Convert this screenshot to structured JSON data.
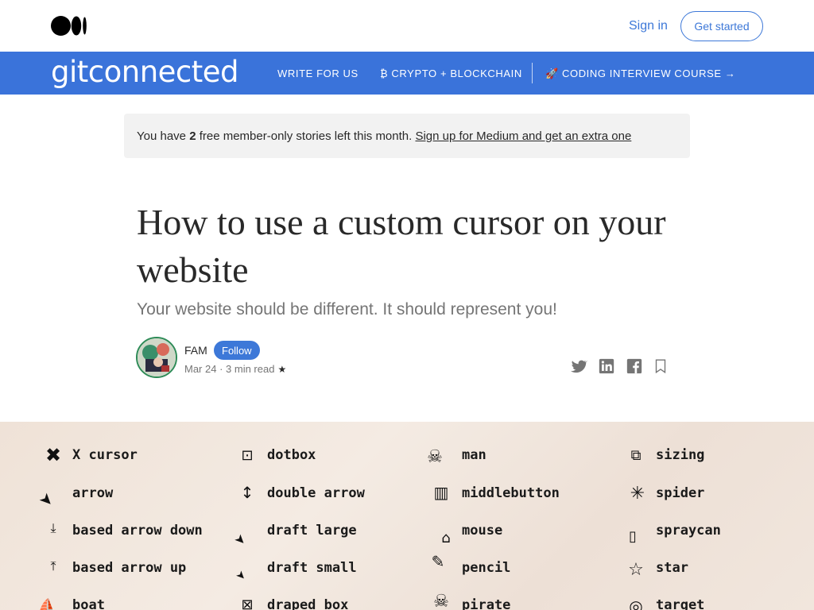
{
  "header": {
    "signin_label": "Sign in",
    "getstarted_label": "Get started"
  },
  "publication": {
    "name": "gitconnected",
    "nav": [
      {
        "label": "WRITE FOR US"
      },
      {
        "label": "₿ CRYPTO + BLOCKCHAIN"
      },
      {
        "label": "🚀 CODING INTERVIEW COURSE →"
      }
    ]
  },
  "banner": {
    "prefix": "You have ",
    "count": "2",
    "middle": " free member-only stories left this month. ",
    "link": "Sign up for Medium and get an extra one"
  },
  "article": {
    "title": "How to use a custom cursor on your website",
    "subtitle": "Your website should be different. It should represent you!",
    "author": "FAM",
    "follow_label": "Follow",
    "date": "Mar 24",
    "read_time": "3 min read",
    "star": "★"
  },
  "share_icons": [
    "twitter-icon",
    "linkedin-icon",
    "facebook-icon",
    "bookmark-icon"
  ],
  "colors": {
    "accent": "#3d78d8",
    "publication_bar": "#3a73da",
    "banner_bg": "#f2f2f2"
  },
  "cursor_table": {
    "col1": [
      "X cursor",
      "arrow",
      "based arrow down",
      "based arrow up",
      "boat"
    ],
    "col2": [
      "dotbox",
      "double arrow",
      "draft large",
      "draft small",
      "draped box"
    ],
    "col3": [
      "man",
      "middlebutton",
      "mouse",
      "pencil",
      "pirate"
    ],
    "col4": [
      "sizing",
      "spider",
      "spraycan",
      "star",
      "target"
    ]
  }
}
